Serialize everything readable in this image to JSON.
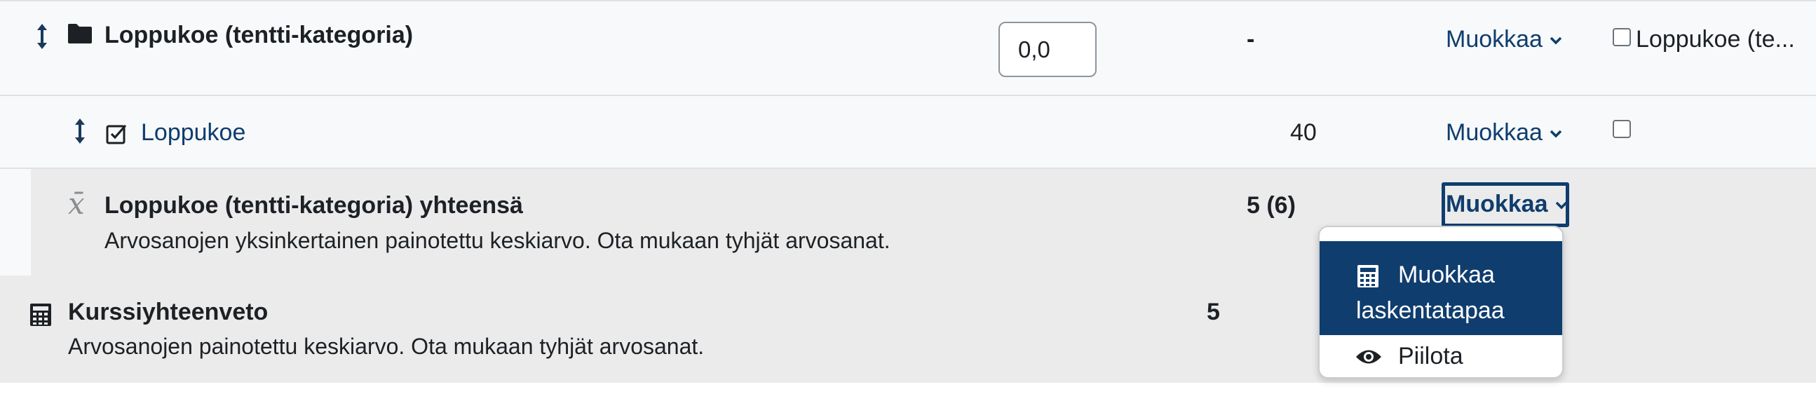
{
  "category": {
    "name": "Loppukoe (tentti-kategoria)",
    "weight_value": "0,0",
    "range": "-",
    "edit_label": "Muokkaa",
    "checkbox_label": "Loppukoe (te..."
  },
  "item": {
    "name": "Loppukoe",
    "value": "40",
    "edit_label": "Muokkaa"
  },
  "category_total": {
    "name": "Loppukoe (tentti-kategoria) yhteensä",
    "description": "Arvosanojen yksinkertainen painotettu keskiarvo. Ota mukaan tyhjät arvosanat.",
    "value": "5 (6)",
    "edit_label": "Muokkaa",
    "icon_glyph": "x̄"
  },
  "course_total": {
    "name": "Kurssiyhteenveto",
    "description": "Arvosanojen painotettu keskiarvo. Ota mukaan tyhjät arvosanat.",
    "value": "5"
  },
  "dropdown_menu": {
    "items": [
      {
        "line1": "Muokkaa",
        "line2": "laskentatapaa",
        "icon": "calculator-icon",
        "active": true
      },
      {
        "label": "Piilota",
        "icon": "eye-icon"
      }
    ]
  },
  "colors": {
    "link": "#0f3d6e",
    "active_menu_bg": "#0f3d6e",
    "row_bg": "#f8f9fa",
    "total_bg": "#ebebeb"
  }
}
